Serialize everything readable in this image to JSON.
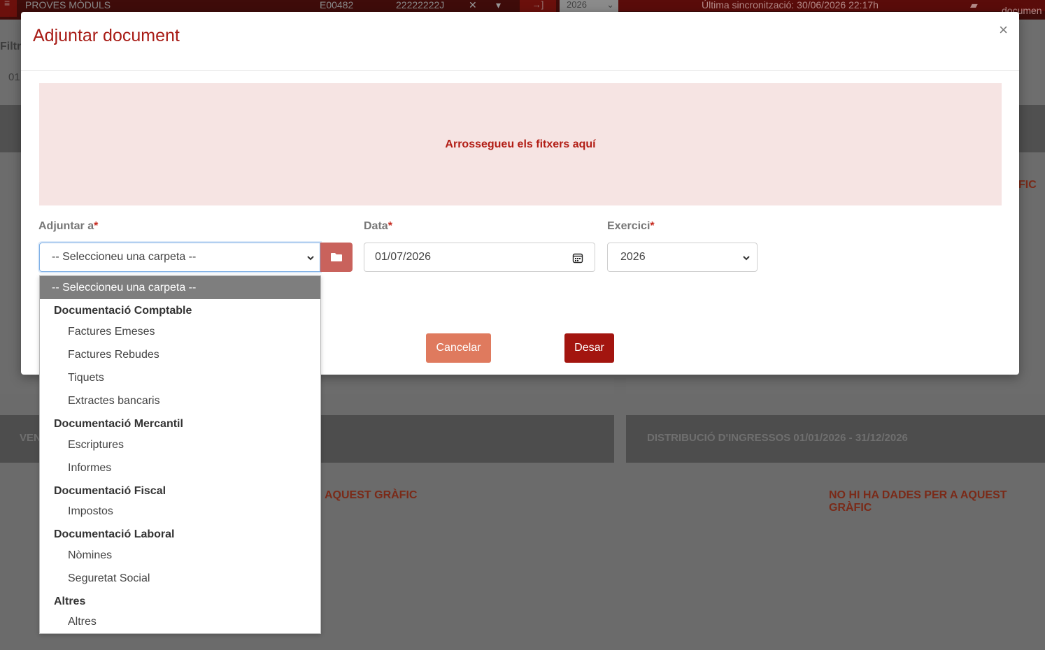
{
  "topbar": {
    "company": "PROVES MÒDULS",
    "code": "E00482",
    "nif": "22222222J",
    "year": "2026",
    "sync": "Última sincronització: 30/06/2026 22:17h",
    "docs_label": "documen"
  },
  "background": {
    "filter_label": "Filtr",
    "filter_value": "01",
    "panel_left_title": "VEN",
    "panel_right_title": "DISTRIBUCIÓ D'INGRESSOS 01/01/2026 - 31/12/2026",
    "nodata_left": "AQUEST GRÀFIC",
    "nodata_right": "NO HI HA DADES PER A AQUEST GRÀFIC",
    "nodata_top_right": "FIC"
  },
  "modal": {
    "title": "Adjuntar document",
    "close": "×",
    "dropzone_text": "Arrossegueu els fitxers aquí",
    "fields": {
      "attach_to": {
        "label": "Adjuntar a",
        "required": "*",
        "value": "-- Seleccioneu una carpeta --"
      },
      "date": {
        "label": "Data",
        "required": "*",
        "value": "01/07/2026"
      },
      "exercise": {
        "label": "Exercici",
        "required": "*",
        "value": "2026"
      }
    },
    "buttons": {
      "cancel": "Cancelar",
      "save": "Desar"
    }
  },
  "dropdown": {
    "selected": "-- Seleccioneu una carpeta --",
    "groups": [
      {
        "label": "Documentació Comptable",
        "options": [
          "Factures Emeses",
          "Factures Rebudes",
          "Tiquets",
          "Extractes bancaris"
        ]
      },
      {
        "label": "Documentació Mercantil",
        "options": [
          "Escriptures",
          "Informes"
        ]
      },
      {
        "label": "Documentació Fiscal",
        "options": [
          "Impostos"
        ]
      },
      {
        "label": "Documentació Laboral",
        "options": [
          "Nòmines",
          "Seguretat Social"
        ]
      },
      {
        "label": "Altres",
        "options": [
          "Altres"
        ]
      }
    ]
  },
  "colors": {
    "brand": "#a81c16",
    "dropzone_bg": "#f6e4e3",
    "cancel": "#df7a5e",
    "save": "#a3150f",
    "folder_button": "#c9625c"
  }
}
